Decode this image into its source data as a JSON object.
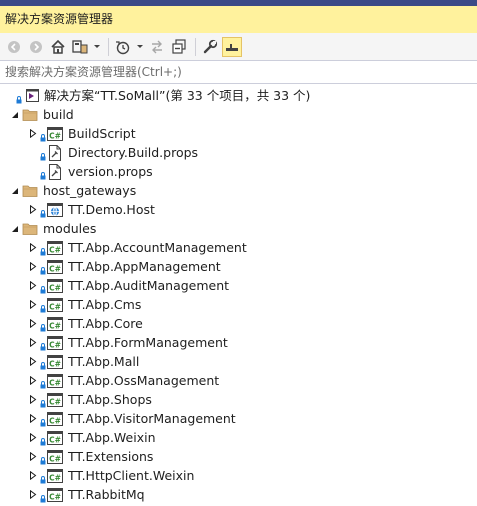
{
  "title": "解决方案资源管理器",
  "search": {
    "placeholder": "搜索解决方案资源管理器(Ctrl+;)"
  },
  "toolbar": [
    "back-icon",
    "forward-icon",
    "home-icon",
    "switch-views-icon",
    "dropdown-icon",
    "history-icon",
    "dropdown-icon",
    "sync-icon",
    "collapse-all-icon",
    "properties-icon",
    "preview-icon"
  ],
  "tree": {
    "solution": "解决方案“TT.SoMall”(第 33 个项目，共 33 个)",
    "folders": [
      {
        "label": "build",
        "items": [
          {
            "label": "BuildScript",
            "icon": "csharp-project-icon"
          },
          {
            "label": "Directory.Build.props",
            "icon": "props-file-icon"
          },
          {
            "label": "version.props",
            "icon": "props-file-icon"
          }
        ]
      },
      {
        "label": "host_gateways",
        "items": [
          {
            "label": "TT.Demo.Host",
            "icon": "web-project-icon"
          }
        ]
      },
      {
        "label": "modules",
        "items": [
          {
            "label": "TT.Abp.AccountManagement",
            "icon": "csharp-project-icon"
          },
          {
            "label": "TT.Abp.AppManagement",
            "icon": "csharp-project-icon"
          },
          {
            "label": "TT.Abp.AuditManagement",
            "icon": "csharp-project-icon"
          },
          {
            "label": "TT.Abp.Cms",
            "icon": "csharp-project-icon"
          },
          {
            "label": "TT.Abp.Core",
            "icon": "csharp-project-icon"
          },
          {
            "label": "TT.Abp.FormManagement",
            "icon": "csharp-project-icon"
          },
          {
            "label": "TT.Abp.Mall",
            "icon": "csharp-project-icon"
          },
          {
            "label": "TT.Abp.OssManagement",
            "icon": "csharp-project-icon"
          },
          {
            "label": "TT.Abp.Shops",
            "icon": "csharp-project-icon"
          },
          {
            "label": "TT.Abp.VisitorManagement",
            "icon": "csharp-project-icon"
          },
          {
            "label": "TT.Abp.Weixin",
            "icon": "csharp-project-icon"
          },
          {
            "label": "TT.Extensions",
            "icon": "csharp-project-icon"
          },
          {
            "label": "TT.HttpClient.Weixin",
            "icon": "csharp-project-icon"
          },
          {
            "label": "TT.RabbitMq",
            "icon": "csharp-project-icon"
          }
        ]
      }
    ]
  },
  "colors": {
    "accent": "#fff29d",
    "folder": "#dcb67a",
    "csharp": "#388a34",
    "lock": "#1e7bd6"
  }
}
